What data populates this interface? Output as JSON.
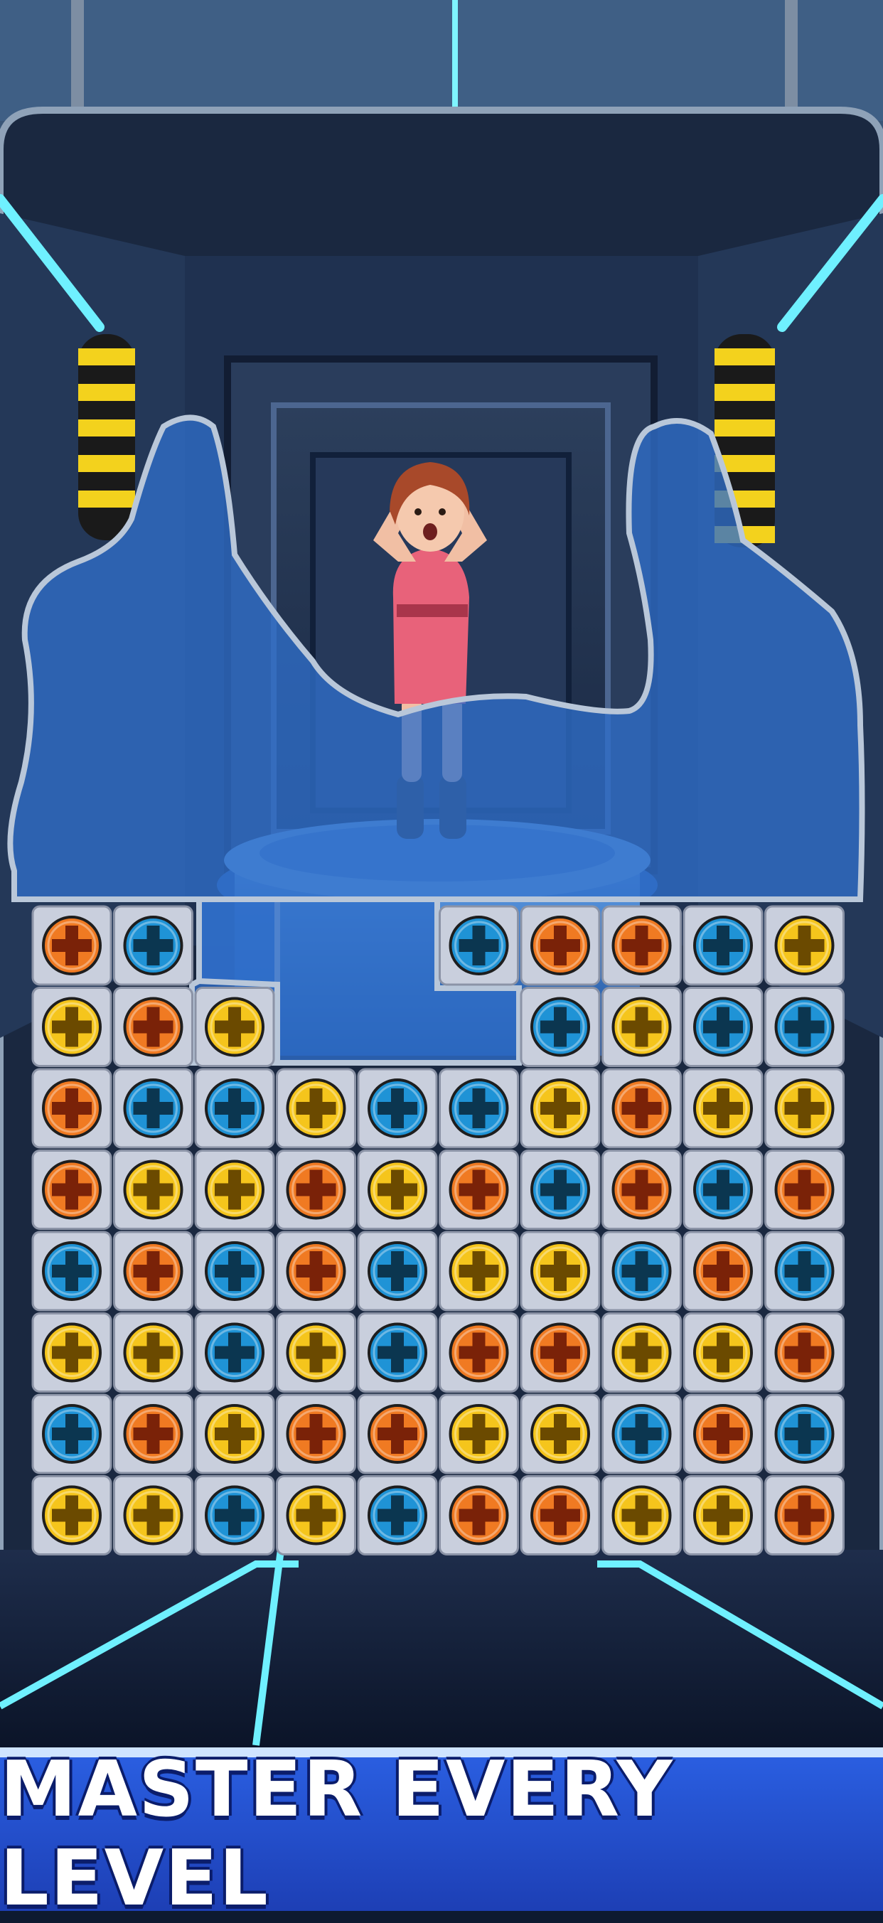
{
  "banner": {
    "text": "MASTER EVERY LEVEL"
  },
  "colors": {
    "orange": "#f07a22",
    "blue": "#1f93d6",
    "yellow": "#f5c51c",
    "tile": "#c9cfdd",
    "glass": "#2f6ec9"
  },
  "grid": {
    "rows": [
      [
        "orange",
        "blue",
        null,
        null,
        null,
        "blue",
        "orange",
        "orange",
        "blue",
        "yellow"
      ],
      [
        "yellow",
        "orange",
        "yellow",
        null,
        null,
        null,
        "blue",
        "yellow",
        "blue",
        "blue"
      ],
      [
        "orange",
        "blue",
        "blue",
        "yellow",
        "blue",
        "blue",
        "yellow",
        "orange",
        "yellow",
        "yellow"
      ],
      [
        "orange",
        "yellow",
        "yellow",
        "orange",
        "yellow",
        "orange",
        "blue",
        "orange",
        "blue",
        "orange"
      ],
      [
        "blue",
        "orange",
        "blue",
        "orange",
        "blue",
        "yellow",
        "yellow",
        "blue",
        "orange",
        "blue"
      ],
      [
        "yellow",
        "yellow",
        "blue",
        "yellow",
        "blue",
        "orange",
        "orange",
        "yellow",
        "yellow",
        "orange"
      ],
      [
        "blue",
        "orange",
        "yellow",
        "orange",
        "orange",
        "yellow",
        "yellow",
        "blue",
        "orange",
        "blue"
      ],
      [
        "yellow",
        "yellow",
        "blue",
        "yellow",
        "blue",
        "orange",
        "orange",
        "yellow",
        "yellow",
        "orange"
      ]
    ]
  }
}
